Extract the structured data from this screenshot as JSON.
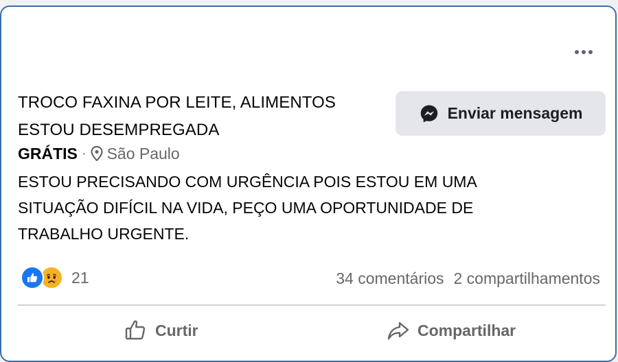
{
  "listing": {
    "title_line1": "TROCO FAXINA POR LEITE, ALIMENTOS",
    "title_line2": "ESTOU DESEMPREGADA",
    "price": "GRÁTIS",
    "separator": "·",
    "location": "São Paulo",
    "description_line1": "ESTOU PRECISANDO COM URGÊNCIA POIS ESTOU EM UMA",
    "description_line2": "SITUAÇÃO DIFÍCIL NA VIDA, PEÇO UMA OPORTUNIDADE DE",
    "description_line3": "TRABALHO URGENTE."
  },
  "actions": {
    "message_label": "Enviar mensagem",
    "like_label": "Curtir",
    "share_label": "Compartilhar"
  },
  "engagement": {
    "reaction_count": "21",
    "comments": "34 comentários",
    "shares": "2 compartilhamentos"
  },
  "icons": {
    "more": "more-options-icon",
    "messenger": "messenger-icon",
    "pin": "map-pin-icon",
    "like_reaction": "like-reaction-icon",
    "sad_reaction": "sad-reaction-icon",
    "like_action": "thumbs-up-icon",
    "share_action": "share-arrow-icon"
  },
  "colors": {
    "accent": "#1877f2",
    "border": "#3b6ea5",
    "secondary_text": "#65676b",
    "button_bg": "#e4e6eb"
  }
}
